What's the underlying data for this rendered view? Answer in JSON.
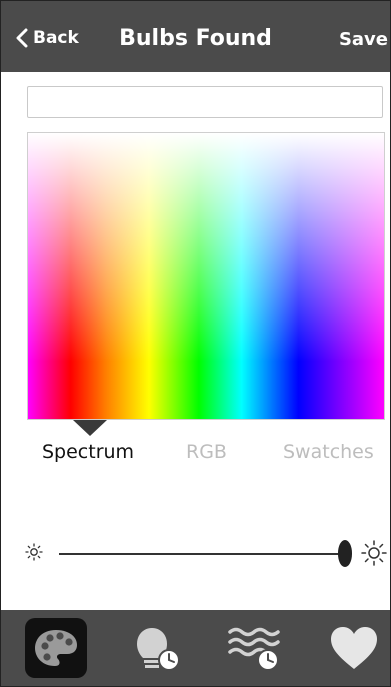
{
  "header": {
    "back_label": "Back",
    "title": "Bulbs Found",
    "save_label": "Save"
  },
  "name_field": {
    "value": "",
    "placeholder": ""
  },
  "color_tabs": [
    {
      "label": "Spectrum",
      "active": true
    },
    {
      "label": "RGB",
      "active": false
    },
    {
      "label": "Swatches",
      "active": false
    }
  ],
  "brightness": {
    "level": 1.0
  },
  "tab_bar": [
    {
      "icon": "palette-icon",
      "selected": true
    },
    {
      "icon": "bulb-schedule-icon",
      "selected": false
    },
    {
      "icon": "waves-schedule-icon",
      "selected": false
    },
    {
      "icon": "heart-icon",
      "selected": false
    }
  ],
  "colors": {
    "header_bg": "#4b4b4b",
    "tabbar_bg": "#4b4b4b",
    "selected_tab_bg": "#111111",
    "active_tab_text": "#111111",
    "inactive_tab_text": "#bdbdbd"
  }
}
